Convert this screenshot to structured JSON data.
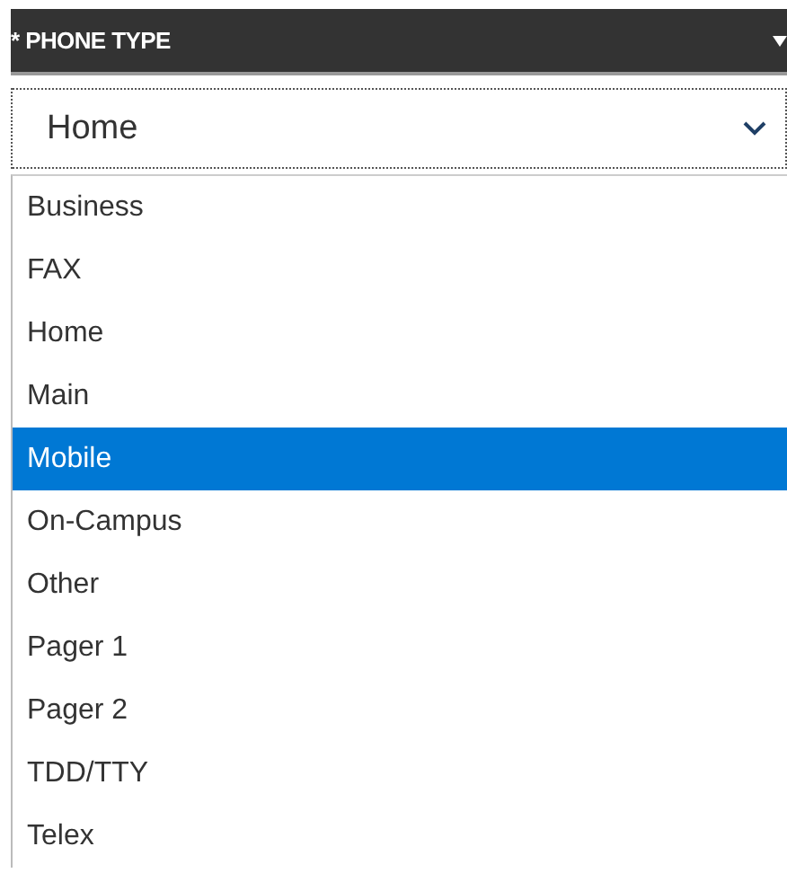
{
  "field": {
    "label": "PHONE TYPE",
    "required_mark": "*",
    "value": "Home"
  },
  "options": [
    {
      "label": "Business",
      "selected": false
    },
    {
      "label": "FAX",
      "selected": false
    },
    {
      "label": "Home",
      "selected": false
    },
    {
      "label": "Main",
      "selected": false
    },
    {
      "label": "Mobile",
      "selected": true
    },
    {
      "label": "On-Campus",
      "selected": false
    },
    {
      "label": "Other",
      "selected": false
    },
    {
      "label": "Pager 1",
      "selected": false
    },
    {
      "label": "Pager 2",
      "selected": false
    },
    {
      "label": "TDD/TTY",
      "selected": false
    },
    {
      "label": "Telex",
      "selected": false
    }
  ]
}
